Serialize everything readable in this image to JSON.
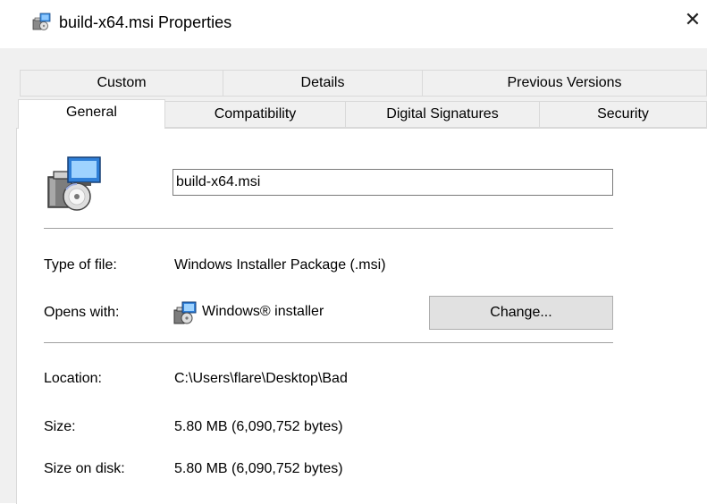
{
  "window": {
    "title": "build-x64.msi Properties",
    "close_glyph": "✕",
    "icon": "msi-package-icon"
  },
  "tabs": {
    "row1": [
      {
        "label": "Custom"
      },
      {
        "label": "Details"
      },
      {
        "label": "Previous Versions"
      }
    ],
    "row2": [
      {
        "label": "General",
        "active": true
      },
      {
        "label": "Compatibility"
      },
      {
        "label": "Digital Signatures"
      },
      {
        "label": "Security"
      }
    ]
  },
  "general": {
    "file_name": "build-x64.msi",
    "type_label": "Type of file:",
    "type_value": "Windows Installer Package (.msi)",
    "opens_label": "Opens with:",
    "opens_value": "Windows® installer",
    "opens_icon": "windows-installer-icon",
    "change_button": "Change...",
    "location_label": "Location:",
    "location_value": "C:\\Users\\flare\\Desktop\\Bad",
    "size_label": "Size:",
    "size_value": "5.80 MB (6,090,752 bytes)",
    "size_on_disk_label": "Size on disk:",
    "size_on_disk_value": "5.80 MB (6,090,752 bytes)"
  },
  "colors": {
    "panel_bg": "#f0f0f0",
    "tab_border": "#d9d9d9",
    "separator": "#a0a0a0",
    "button_bg": "#e1e1e1"
  }
}
